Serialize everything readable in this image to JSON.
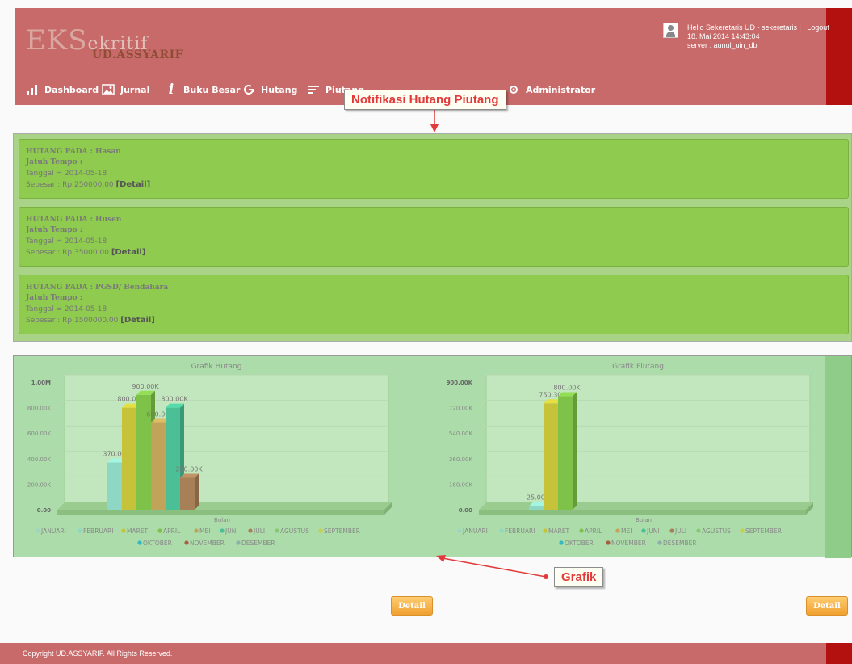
{
  "logo": {
    "main": "EKS",
    "main_small": "ekritif",
    "sub": "UD.ASSYARIF"
  },
  "user": {
    "greeting": "Hello Sekeretaris UD - sekeretaris | | Logout",
    "datetime": "18. Mai 2014 14:43:04",
    "server": "server : aunul_uin_db"
  },
  "nav": {
    "items": [
      {
        "label": "Dashboard",
        "icon": "bar-chart-icon"
      },
      {
        "label": "Jurnal",
        "icon": "image-icon"
      },
      {
        "label": "Buku Besar",
        "icon": "info-icon"
      },
      {
        "label": "Hutang",
        "icon": "google-icon"
      },
      {
        "label": "Piutang",
        "icon": "list-icon"
      },
      {
        "label": "Administrator",
        "icon": "settings-icon"
      }
    ]
  },
  "callouts": {
    "notifikasi": "Notifikasi Hutang Piutang",
    "grafik": "Grafik"
  },
  "notifications": [
    {
      "title": "HUTANG PADA : Hasan",
      "due": "Jatuh Tempo :",
      "date": "Tanggal = 2014-05-18",
      "amount": "Sebesar : Rp 250000.00",
      "detail": "[Detail]"
    },
    {
      "title": "HUTANG PADA : Husen",
      "due": "Jatuh Tempo :",
      "date": "Tanggal = 2014-05-18",
      "amount": "Sebesar : Rp 35000.00",
      "detail": "[Detail]"
    },
    {
      "title": "HUTANG PADA : PGSD/ Bendahara",
      "due": "Jatuh Tempo :",
      "date": "Tanggal = 2014-05-18",
      "amount": "Sebesar : Rp 1500000.00",
      "detail": "[Detail]"
    }
  ],
  "colors": {
    "header": "#c96a6a",
    "header_strip": "#b31010",
    "notif_card": "#8ecb4e",
    "chart_panel": "#acdcaa",
    "detail_button": "#f0a030"
  },
  "chart_data": [
    {
      "type": "bar",
      "title": "Grafik Hutang",
      "xlabel": "Bulan",
      "ylim": [
        0,
        1000000
      ],
      "y_ticks": [
        "0.00",
        "200.00K",
        "400.00K",
        "600.00K",
        "800.00K",
        "1.00M"
      ],
      "legend_position": "bottom",
      "series": [
        {
          "name": "JANUARI",
          "value": 0,
          "label": "",
          "color": "#9ed3c8"
        },
        {
          "name": "FEBRUARI",
          "value": 370000,
          "label": "370.00K",
          "color": "#8ed7c4"
        },
        {
          "name": "MARET",
          "value": 800000,
          "label": "800.00K",
          "color": "#c6c23a"
        },
        {
          "name": "APRIL",
          "value": 900000,
          "label": "900.00K",
          "color": "#7fc24a"
        },
        {
          "name": "MEI",
          "value": 680000,
          "label": "680.00K",
          "color": "#c1a45a"
        },
        {
          "name": "JUNI",
          "value": 800000,
          "label": "800.00K",
          "color": "#4bbf95"
        },
        {
          "name": "JULI",
          "value": 250000,
          "label": "250.00K",
          "color": "#a88058"
        },
        {
          "name": "AGUSTUS",
          "value": 0,
          "label": "",
          "color": "#86c877"
        },
        {
          "name": "SEPTEMBER",
          "value": 0,
          "label": "",
          "color": "#c6d04a"
        },
        {
          "name": "OKTOBER",
          "value": 0,
          "label": "",
          "color": "#37b8bf"
        },
        {
          "name": "NOVEMBER",
          "value": 0,
          "label": "",
          "color": "#a86045"
        },
        {
          "name": "DESEMBER",
          "value": 0,
          "label": "",
          "color": "#8cb0a8"
        }
      ]
    },
    {
      "type": "bar",
      "title": "Grafik Piutang",
      "xlabel": "Bulan",
      "ylim": [
        0,
        900000
      ],
      "y_ticks": [
        "0.00",
        "180.00K",
        "360.00K",
        "540.00K",
        "720.00K",
        "900.00K"
      ],
      "legend_position": "bottom",
      "series": [
        {
          "name": "JANUARI",
          "value": 0,
          "label": "",
          "color": "#9ed3c8"
        },
        {
          "name": "FEBRUARI",
          "value": 25000,
          "label": "25.00K",
          "color": "#8ed7c4"
        },
        {
          "name": "MARET",
          "value": 750300,
          "label": "750.30K",
          "color": "#c6c23a"
        },
        {
          "name": "APRIL",
          "value": 800000,
          "label": "800.00K",
          "color": "#7fc24a"
        },
        {
          "name": "MEI",
          "value": 0,
          "label": "",
          "color": "#c1a45a"
        },
        {
          "name": "JUNI",
          "value": 0,
          "label": "",
          "color": "#4bbf95"
        },
        {
          "name": "JULI",
          "value": 0,
          "label": "",
          "color": "#a88058"
        },
        {
          "name": "AGUSTUS",
          "value": 0,
          "label": "",
          "color": "#86c877"
        },
        {
          "name": "SEPTEMBER",
          "value": 0,
          "label": "",
          "color": "#c6d04a"
        },
        {
          "name": "OKTOBER",
          "value": 0,
          "label": "",
          "color": "#37b8bf"
        },
        {
          "name": "NOVEMBER",
          "value": 0,
          "label": "",
          "color": "#a86045"
        },
        {
          "name": "DESEMBER",
          "value": 0,
          "label": "",
          "color": "#8cb0a8"
        }
      ]
    }
  ],
  "buttons": {
    "detail_left": "Detail",
    "detail_right": "Detail"
  },
  "footer": {
    "text": "Copyright UD.ASSYARIF. All Rights Reserved."
  }
}
